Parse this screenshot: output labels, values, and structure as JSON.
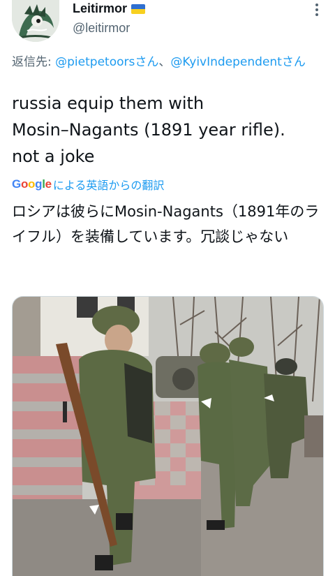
{
  "header": {
    "display_name": "Leitirmor",
    "handle": "@leitirmor",
    "flag_icon": "ukraine-flag-icon",
    "more_icon": "more-options-icon",
    "flag_colors": [
      "#2f6fd0",
      "#f7d020"
    ]
  },
  "reply": {
    "prefix": "返信先: ",
    "mention1": "@pietpetoorsさん",
    "separator": "、",
    "mention2": "@KyivIndependentさん"
  },
  "tweet": {
    "text": "russia equip them with\nMosin–Nagants (1891 year rifle).\nnot a joke"
  },
  "translation": {
    "brand_letters": [
      "G",
      "o",
      "o",
      "g",
      "l",
      "e"
    ],
    "label": "による英語からの翻訳",
    "text": "ロシアは彼らにMosin-Nagants（1891年のライフル）を装備しています。冗談じゃない"
  },
  "media": {
    "icon": "photo-soldiers-with-rifle"
  },
  "colors": {
    "accent": "#1d9bf0",
    "secondary_text": "#536471",
    "primary_text": "#0f1419"
  }
}
